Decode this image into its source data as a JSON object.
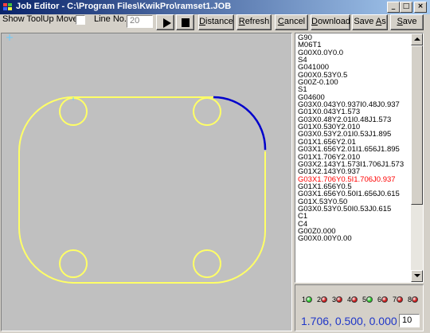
{
  "window": {
    "title": "Job Editor - C:\\Program Files\\KwikPro\\ramset1.JOB",
    "minimize": "_",
    "maximize": "□",
    "close": "×"
  },
  "toolbar": {
    "show_toolup_label": "Show ToolUp Moves",
    "line_no_label": "Line No.",
    "line_no_value": "20",
    "distance_label_pre": "",
    "distance_label_u": "D",
    "distance_label_post": "istance",
    "refresh_u": "R",
    "refresh_post": "efresh",
    "cancel_u": "C",
    "cancel_post": "ancel",
    "download_u": "D",
    "download_post": "ownload",
    "saveas_pre": "Save ",
    "saveas_u": "A",
    "saveas_post": "s",
    "save_u": "S",
    "save_post": "ave"
  },
  "code_lines": [
    "G90",
    "M06T1",
    "G00X0.0Y0.0",
    "S4",
    "G041000",
    "G00X0.53Y0.5",
    "G00Z-0.100",
    "S1",
    "G04600",
    "G03X0.043Y0.937I0.48J0.937",
    "G01X0.043Y1.573",
    "G03X0.48Y2.01I0.48J1.573",
    "G01X0.530Y2.010",
    "G03X0.53Y2.01I0.53J1.895",
    "G01X1.656Y2.01",
    "G03X1.656Y2.01I1.656J1.895",
    "G01X1.706Y2.010",
    "G03X2.143Y1.573I1.706J1.573",
    "G01X2.143Y0.937",
    "G03X1.706Y0.5I1.706J0.937",
    "G01X1.656Y0.5",
    "G03X1.656Y0.50I1.656J0.615",
    "G01X.53Y0.50",
    "G03X0.53Y0.50I0.53J0.615",
    "C1",
    "C4",
    "G00Z0.000",
    "G00X0.00Y0.00"
  ],
  "highlight_index": 19,
  "status": {
    "leds": [
      {
        "num": "1",
        "color": "#22cc22"
      },
      {
        "num": "2",
        "color": "#cc1111"
      },
      {
        "num": "3",
        "color": "#cc1111"
      },
      {
        "num": "4",
        "color": "#cc1111"
      },
      {
        "num": "5",
        "color": "#22cc22"
      },
      {
        "num": "6",
        "color": "#cc1111"
      },
      {
        "num": "7",
        "color": "#cc1111"
      },
      {
        "num": "8",
        "color": "#cc1111"
      }
    ],
    "coordinates": "1.706, 0.500, 0.000",
    "step_value": "10"
  },
  "colors": {
    "toolpath": "#ffff66",
    "current_move": "#0000cc",
    "canvas_bg": "#c0c0c0",
    "origin_marker": "#66ccff"
  }
}
